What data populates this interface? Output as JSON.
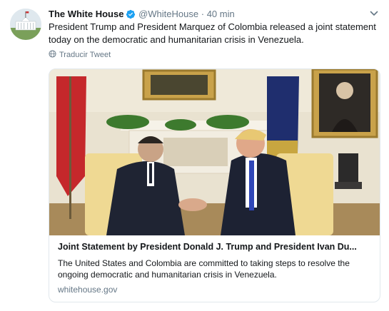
{
  "tweet": {
    "account_name": "The White House",
    "handle": "@WhiteHouse",
    "separator": "·",
    "time": "40 min",
    "text": "President Trump and President Marquez of Colombia released a joint statement today on the democratic and humanitarian crisis in Venezuela.",
    "translate_label": "Traducir Tweet"
  },
  "card": {
    "title": "Joint Statement by President Donald J. Trump and President Ivan Du...",
    "description": "The United States and Colombia are committed to taking steps to resolve the ongoing democratic and humanitarian crisis in Venezuela.",
    "domain": "whitehouse.gov"
  },
  "colors": {
    "text": "#14171a",
    "secondary": "#657786",
    "verified": "#1da1f2",
    "border": "#e1e8ed"
  },
  "icons": {
    "verified": "verified-badge-icon",
    "caret": "chevron-down-icon",
    "translate": "globe-icon"
  }
}
